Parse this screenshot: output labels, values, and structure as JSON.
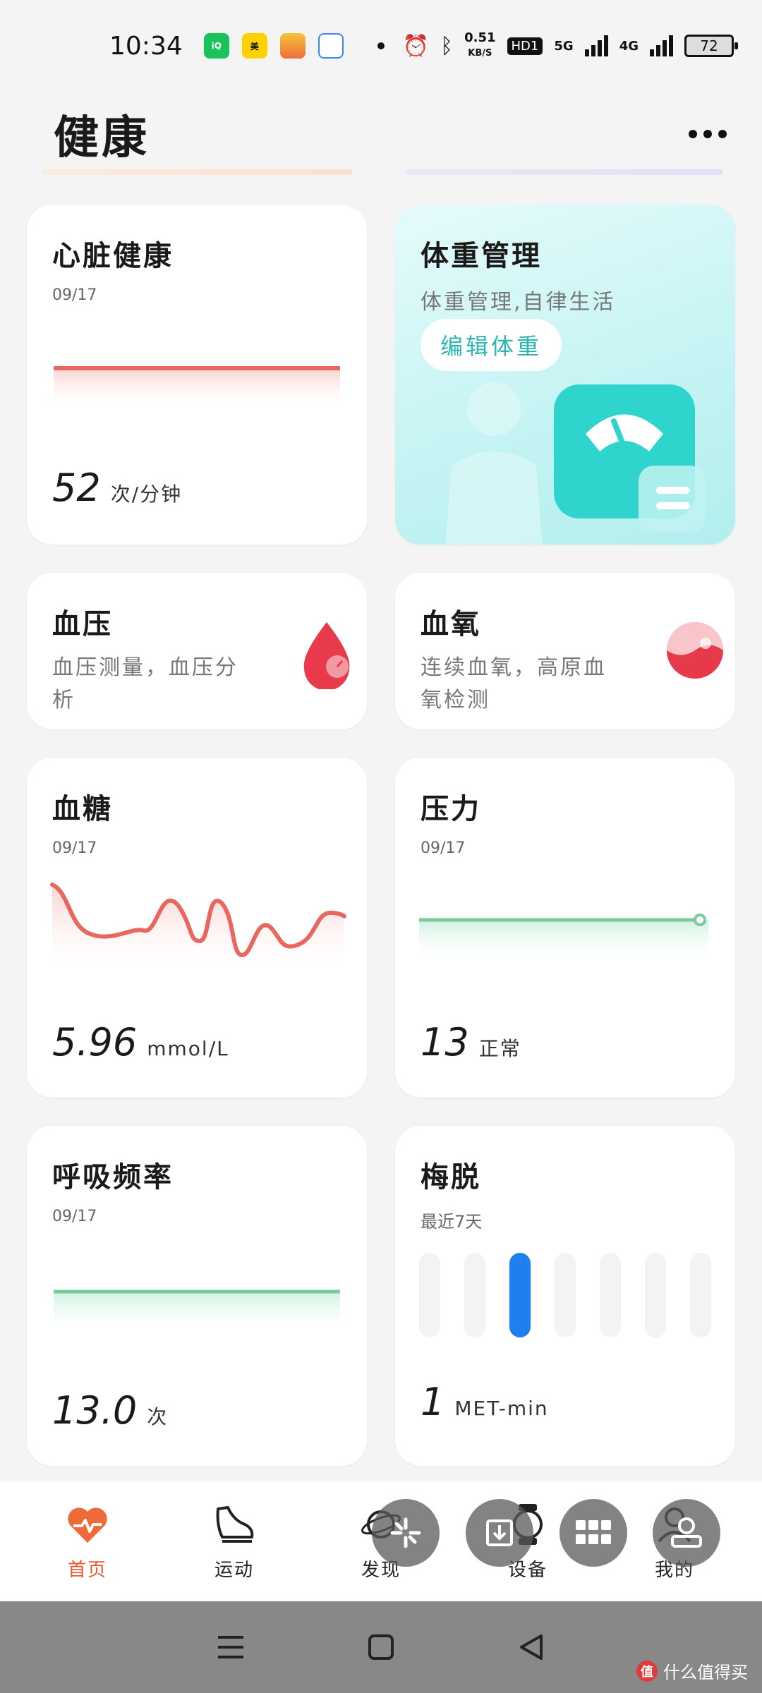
{
  "status_bar": {
    "time": "10:34",
    "apps": [
      {
        "name": "iqiyi-icon",
        "label": "iQIYI",
        "color": "#00c060"
      },
      {
        "name": "meituan-icon",
        "label": "美团",
        "color": "#ffd000"
      },
      {
        "name": "card-icon",
        "label": "",
        "color": "#f08a24"
      },
      {
        "name": "maps-icon",
        "label": "",
        "color": "#ffffff"
      }
    ],
    "speed_value": "0.51",
    "speed_unit": "KB/S",
    "hd_label": "HD1",
    "network_1": "5G",
    "network_2": "4G",
    "battery": "72"
  },
  "header": {
    "title": "健康"
  },
  "cards": {
    "heart": {
      "title": "心脏健康",
      "date": "09/17",
      "value": "52",
      "unit": "次/分钟",
      "line_color": "#e8675f"
    },
    "weight": {
      "title": "体重管理",
      "subtitle": "体重管理,自律生活",
      "button": "编辑体重",
      "accent": "#2fd5cc"
    },
    "blood_pressure": {
      "title": "血压",
      "subtitle_line1": "血压测量，血压分",
      "subtitle_line2": "析"
    },
    "blood_oxygen": {
      "title": "血氧",
      "subtitle_line1": "连续血氧，高原血",
      "subtitle_line2": "氧检测"
    },
    "blood_sugar": {
      "title": "血糖",
      "date": "09/17",
      "value": "5.96",
      "unit": "mmol/L",
      "line_color": "#e8675f"
    },
    "stress": {
      "title": "压力",
      "date": "09/17",
      "value": "13",
      "unit": "正常",
      "line_color": "#7cc99a"
    },
    "respiratory": {
      "title": "呼吸频率",
      "date": "09/17",
      "value": "13.0",
      "unit": "次",
      "line_color": "#7cc99a"
    },
    "mets": {
      "title": "梅脱",
      "subtitle": "最近7天",
      "value": "1",
      "unit": "MET-min",
      "bars_active_index": 2,
      "bar_count": 7,
      "active_color": "#1e7ff0"
    }
  },
  "nav": {
    "items": [
      {
        "label": "首页",
        "icon": "heart-pulse-icon",
        "active": true
      },
      {
        "label": "运动",
        "icon": "shoe-icon",
        "active": false
      },
      {
        "label": "发现",
        "icon": "planet-icon",
        "active": false
      },
      {
        "label": "设备",
        "icon": "watch-icon",
        "active": false
      },
      {
        "label": "我的",
        "icon": "profile-icon",
        "active": false
      }
    ],
    "active_color": "#e8582c"
  },
  "watermark": {
    "logo": "值",
    "text": "什么值得买"
  }
}
